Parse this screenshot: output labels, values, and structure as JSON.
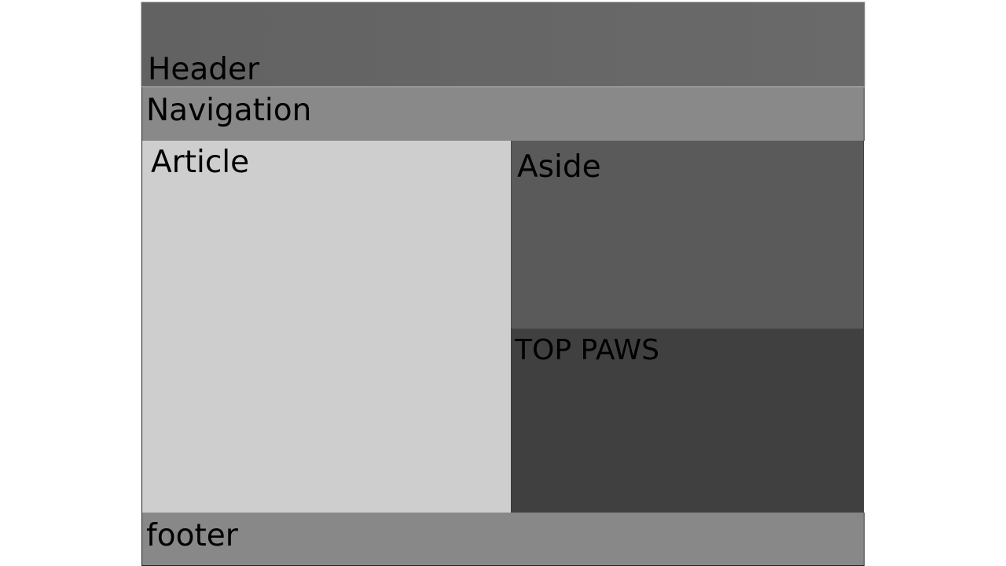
{
  "layout": {
    "header": {
      "label": "Header"
    },
    "navigation": {
      "label": "Navigation"
    },
    "article": {
      "label": "Article"
    },
    "aside": {
      "label": "Aside"
    },
    "top_paws": {
      "label": "TOP PAWS"
    },
    "footer": {
      "label": "footer"
    }
  },
  "colors": {
    "header": "#666666",
    "navigation": "#898989",
    "article": "#cecece",
    "aside": "#5a5a5a",
    "top_paws": "#404040",
    "footer": "#888888"
  }
}
